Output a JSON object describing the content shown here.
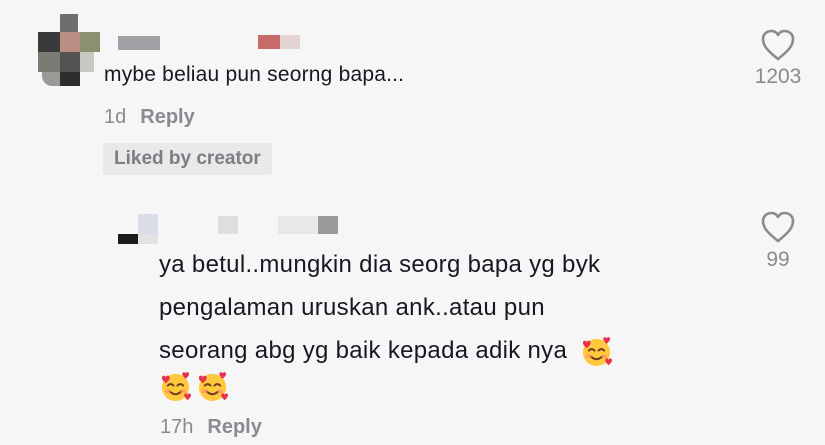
{
  "comment": {
    "text": "mybe beliau pun seorng bapa...",
    "age": "1d",
    "reply_label": "Reply",
    "liked_badge": "Liked by creator",
    "like_count": "1203"
  },
  "reply": {
    "line1": "ya betul..mungkin dia seorg bapa yg byk",
    "line2": "pengalaman uruskan ank..atau pun",
    "line3": "seorang abg yg baik kepada adik nya",
    "age": "17h",
    "reply_label": "Reply",
    "like_count": "99",
    "emoji_name": "smiling-face-with-hearts"
  },
  "colors": {
    "background": "#f6f6f6",
    "text": "#161823",
    "muted": "#8a8b91",
    "badge_bg": "#e9e9ea"
  }
}
